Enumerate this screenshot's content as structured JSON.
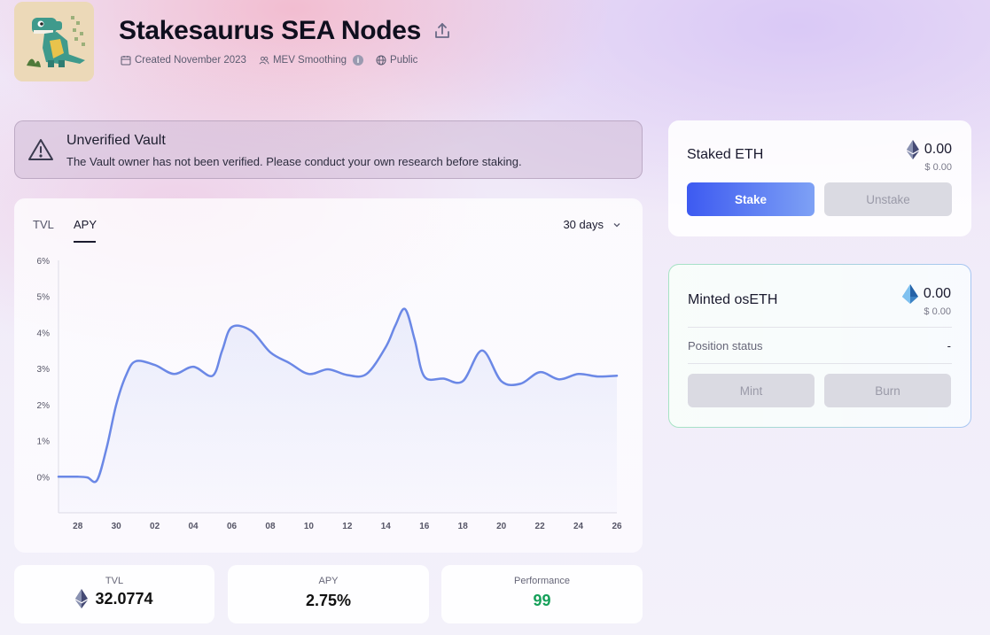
{
  "header": {
    "title": "Stakesaurus SEA Nodes",
    "created": "Created November 2023",
    "mev": "MEV Smoothing",
    "visibility": "Public"
  },
  "warning": {
    "title": "Unverified Vault",
    "text": "The Vault owner has not been verified. Please conduct your own research before staking."
  },
  "chart_card": {
    "tabs": [
      "TVL",
      "APY"
    ],
    "active_tab": "APY",
    "period": "30 days"
  },
  "chart_data": {
    "type": "line",
    "title": "",
    "xlabel": "",
    "ylabel": "",
    "ylim": [
      -1,
      6
    ],
    "y_ticks": [
      "6%",
      "5%",
      "4%",
      "3%",
      "2%",
      "1%",
      "0%"
    ],
    "y_tick_values": [
      6,
      5,
      4,
      3,
      2,
      1,
      0
    ],
    "x_ticks": [
      "28",
      "30",
      "02",
      "04",
      "06",
      "08",
      "10",
      "12",
      "14",
      "16",
      "18",
      "20",
      "22",
      "24",
      "26"
    ],
    "x_tick_positions": [
      0,
      2,
      4,
      6,
      8,
      10,
      12,
      14,
      16,
      18,
      20,
      22,
      24,
      26,
      28
    ],
    "grid": false,
    "series": [
      {
        "values": [
          [
            -1,
            0.0
          ],
          [
            0,
            0.0
          ],
          [
            0.5,
            -0.02
          ],
          [
            1,
            -0.1
          ],
          [
            1.5,
            0.8
          ],
          [
            2,
            2.0
          ],
          [
            2.5,
            2.8
          ],
          [
            3,
            3.2
          ],
          [
            4,
            3.1
          ],
          [
            5,
            2.85
          ],
          [
            6,
            3.05
          ],
          [
            7,
            2.8
          ],
          [
            7.5,
            3.5
          ],
          [
            8,
            4.15
          ],
          [
            9,
            4.05
          ],
          [
            10,
            3.45
          ],
          [
            11,
            3.15
          ],
          [
            12,
            2.85
          ],
          [
            13,
            2.98
          ],
          [
            14,
            2.82
          ],
          [
            15,
            2.85
          ],
          [
            16,
            3.6
          ],
          [
            16.5,
            4.2
          ],
          [
            17,
            4.65
          ],
          [
            17.5,
            3.8
          ],
          [
            18,
            2.78
          ],
          [
            19,
            2.72
          ],
          [
            20,
            2.65
          ],
          [
            21,
            3.5
          ],
          [
            22,
            2.65
          ],
          [
            23,
            2.58
          ],
          [
            24,
            2.9
          ],
          [
            25,
            2.7
          ],
          [
            26,
            2.85
          ],
          [
            27,
            2.78
          ],
          [
            28,
            2.8
          ]
        ],
        "color": "#6b88e6"
      }
    ]
  },
  "stats": {
    "tvl_label": "TVL",
    "tvl_value": "32.0774",
    "apy_label": "APY",
    "apy_value": "2.75%",
    "performance_label": "Performance",
    "performance_value": "99"
  },
  "staked": {
    "title": "Staked ETH",
    "amount": "0.00",
    "usd": "$ 0.00",
    "stake_label": "Stake",
    "unstake_label": "Unstake"
  },
  "minted": {
    "title": "Minted osETH",
    "amount": "0.00",
    "usd": "$ 0.00",
    "position_label": "Position status",
    "position_value": "-",
    "mint_label": "Mint",
    "burn_label": "Burn"
  },
  "colors": {
    "accent": "#3d5af1",
    "line": "#6b88e6",
    "performance": "#16a05a"
  },
  "icons": [
    "share-icon",
    "calendar-icon",
    "users-icon",
    "info-icon",
    "globe-icon",
    "warning-icon",
    "chevron-down-icon",
    "eth-icon",
    "oseth-icon"
  ]
}
